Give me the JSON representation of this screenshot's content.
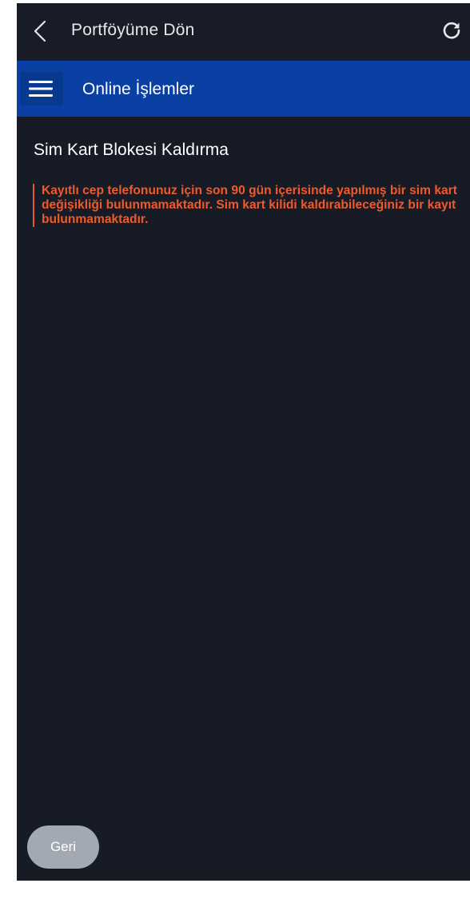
{
  "topbar": {
    "back_label": "Portföyüme Dön",
    "back_icon": "chevron-left-icon",
    "refresh_icon": "refresh-icon"
  },
  "navbar": {
    "menu_icon": "hamburger-menu-icon",
    "title": "Online İşlemler"
  },
  "main": {
    "title": "Sim Kart Blokesi Kaldırma",
    "alert_text": "Kayıtlı cep telefonunuz için son 90 gün içerisinde yapılmış bir sim kart değişikliği bulunmamaktadır. Sim kart kilidi kaldırabileceğiniz bir kayıt bulunmamaktadır.",
    "alert_color": "#f05a2a"
  },
  "footer": {
    "back_button_label": "Geri"
  },
  "colors": {
    "background": "#161b25",
    "navbar": "#0a3fa3",
    "button": "#a3a9b3"
  }
}
